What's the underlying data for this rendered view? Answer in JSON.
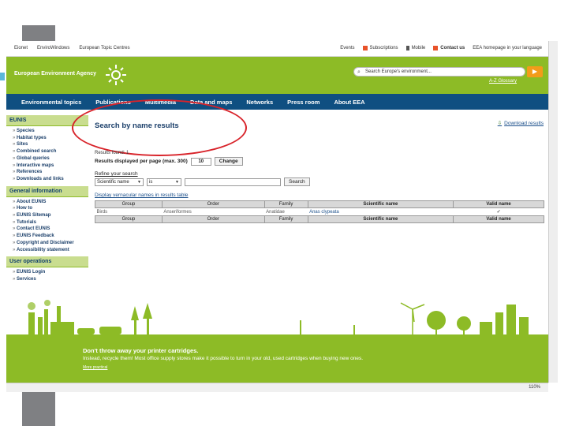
{
  "top_links_left": [
    "Eionet",
    "EnviroWindows",
    "European Topic Centres"
  ],
  "top_links_right": {
    "events": "Events",
    "subscriptions": "Subscriptions",
    "mobile": "Mobile",
    "contact": "Contact us",
    "homepage_language": "EEA homepage in your language"
  },
  "header": {
    "agency_name": "European Environment Agency",
    "search_placeholder": "Search Europe's environment...",
    "search_button": "▶",
    "glossary": "A-Z Glossary"
  },
  "nav": [
    "Environmental topics",
    "Publications",
    "Multimedia",
    "Data and maps",
    "Networks",
    "Press room",
    "About EEA"
  ],
  "sidebar": {
    "eunis": {
      "title": "EUNIS",
      "items": [
        "Species",
        "Habitat types",
        "Sites",
        "Combined search",
        "Global queries",
        "Interactive maps",
        "References",
        "Downloads and links"
      ]
    },
    "general": {
      "title": "General information",
      "items": [
        "About EUNIS",
        "How to",
        "EUNIS Sitemap",
        "Tutorials",
        "Contact EUNIS",
        "EUNIS Feedback",
        "Copyright and Disclaimer",
        "Accessibility statement"
      ]
    },
    "user": {
      "title": "User operations",
      "items": [
        "EUNIS Login",
        "Services"
      ]
    }
  },
  "main": {
    "title": "Search by name results",
    "download": "Download results",
    "results_found": "Results found: 1",
    "per_page_label": "Results displayed per page (max. 300)",
    "per_page_value": "10",
    "change_button": "Change",
    "refine_label": "Refine your search",
    "refine_field": "Scientific name",
    "refine_operator": "is",
    "refine_value": "",
    "search_button": "Search",
    "vernacular_link": "Display vernacular names in results table",
    "columns": [
      "Group",
      "Order",
      "Family",
      "Scientific name",
      "Valid name"
    ],
    "rows": [
      {
        "group": "Birds",
        "order": "Anseriformes",
        "family": "Anatidae",
        "scientific": "Anas clypeata",
        "valid": "✓"
      }
    ]
  },
  "footer": {
    "headline": "Don't throw away your printer cartridges.",
    "body": "Instead, recycle them! Most office supply stores make it possible to turn in your old, used cartridges when buying new ones.",
    "link": "More practical"
  },
  "statusbar": {
    "zoom": "110%"
  },
  "colors": {
    "green": "#8dbb26",
    "nav_blue": "#0f4f81",
    "orange": "#f39c1a",
    "annotation_red": "#d8232a"
  }
}
